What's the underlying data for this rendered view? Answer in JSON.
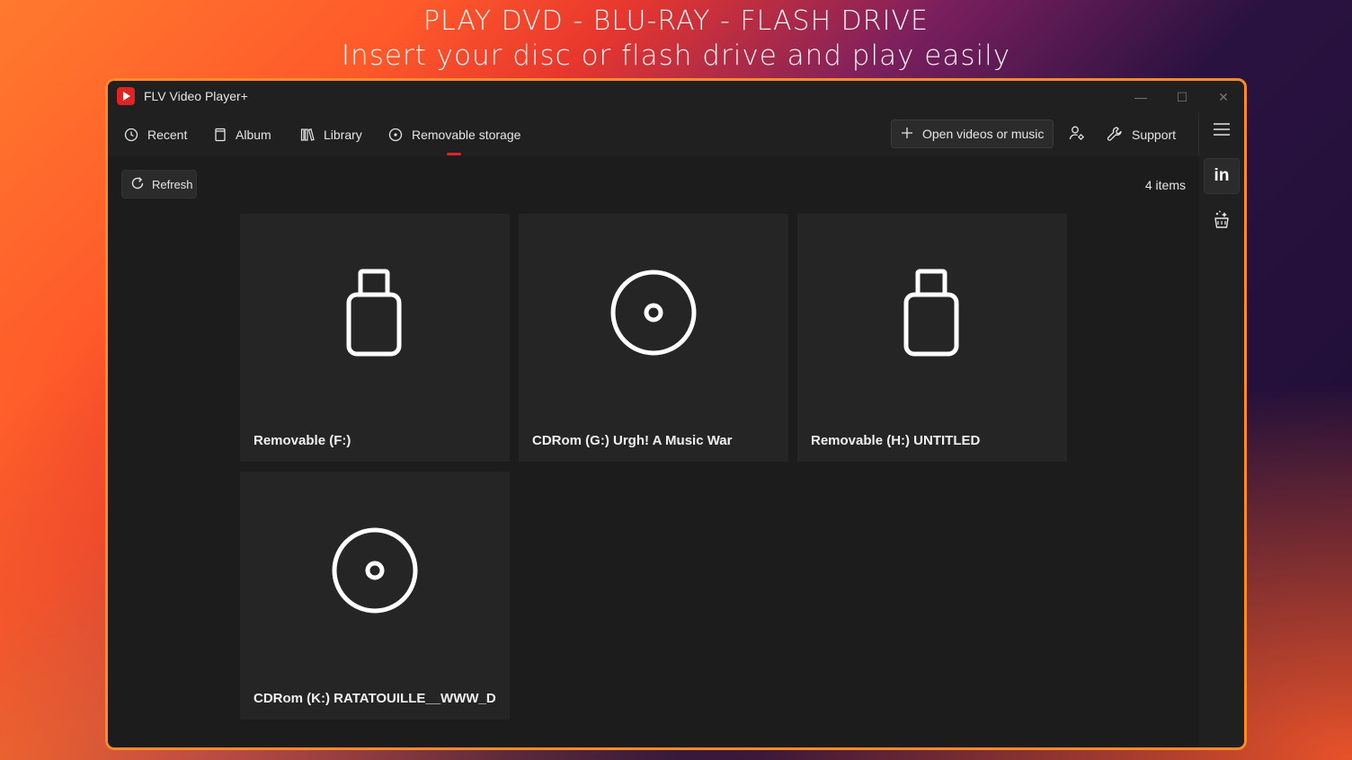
{
  "banner": {
    "line1": "PLAY DVD - BLU-RAY - FLASH DRIVE",
    "line2": "Insert your disc or flash drive and play easily"
  },
  "window": {
    "title": "FLV Video Player+",
    "controls": {
      "minimize": "—",
      "maximize": "☐",
      "close": "✕"
    }
  },
  "nav": {
    "recent": "Recent",
    "album": "Album",
    "library": "Library",
    "removable": "Removable storage",
    "active": "removable"
  },
  "actions": {
    "open": "Open videos or music",
    "support": "Support"
  },
  "content": {
    "refresh": "Refresh",
    "count": "4 items",
    "items": [
      {
        "label": "Removable (F:)",
        "icon": "usb-drive-icon"
      },
      {
        "label": "CDRom (G:) Urgh! A Music War",
        "icon": "disc-icon"
      },
      {
        "label": "Removable (H:) UNTITLED",
        "icon": "usb-drive-icon"
      },
      {
        "label": "CDRom (K:) RATATOUILLE__WWW_DVD",
        "icon": "disc-icon"
      }
    ]
  },
  "colors": {
    "accent": "#e02424",
    "window_border": "#ff8a2a"
  }
}
